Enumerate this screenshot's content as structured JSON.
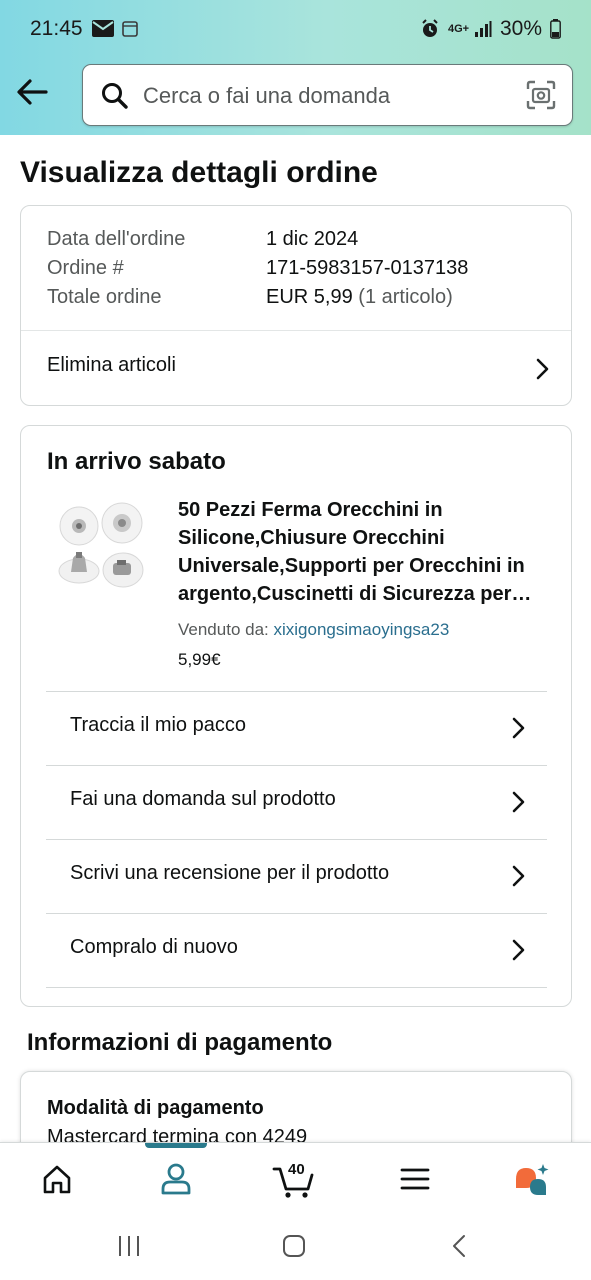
{
  "status_bar": {
    "time": "21:45",
    "battery": "30%",
    "network": "4G+"
  },
  "search": {
    "placeholder": "Cerca o fai una domanda"
  },
  "page_title": "Visualizza dettagli ordine",
  "order_summary": {
    "rows": [
      {
        "label": "Data dell'ordine",
        "value": "1 dic 2024"
      },
      {
        "label": "Ordine #",
        "value": "171-5983157-0137138"
      },
      {
        "label": "Totale ordine",
        "value": "EUR 5,99",
        "extra": "(1 articolo)"
      }
    ],
    "delete_items": "Elimina articoli"
  },
  "shipment": {
    "title": "In arrivo sabato",
    "product_title": "50 Pezzi Ferma Orecchini in Silicone,Chiusure Orecchini Universale,Supporti per Orecchini in argento,Cuscinetti di Sicurezza per Orecchini",
    "sold_by_label": "Venduto da:",
    "seller": "xixigongsimaoyingsa23",
    "price": "5,99€",
    "actions": [
      "Traccia il mio pacco",
      "Fai una domanda sul prodotto",
      "Scrivi una recensione per il prodotto",
      "Compralo di nuovo"
    ]
  },
  "payment": {
    "title": "Informazioni di pagamento",
    "method_label": "Modalità di pagamento",
    "method_value": "Mastercard termina con 4249"
  },
  "bottom_nav": {
    "items": [
      "home-icon",
      "account-icon",
      "cart-icon",
      "menu-icon",
      "rufus-icon"
    ],
    "cart_count": "40",
    "active": "account-icon"
  },
  "colors": {
    "accent": "#2a7a8c",
    "link": "#2a6e8e",
    "header_start": "#82d8e3",
    "header_end": "#a5e2c9"
  }
}
